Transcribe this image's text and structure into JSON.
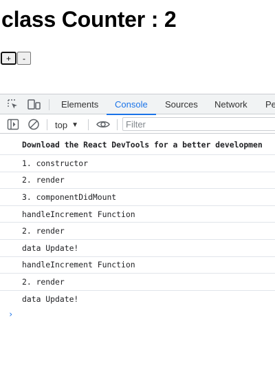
{
  "page": {
    "title": "class Counter : 2",
    "increment_label": "+",
    "decrement_label": "-"
  },
  "devtools": {
    "tabs": [
      "Elements",
      "Console",
      "Sources",
      "Network",
      "Pe"
    ],
    "active_tab": "Console",
    "icons": {
      "inspect": "select-element-icon",
      "device": "device-toolbar-icon",
      "sidebar": "sidebar-toggle-icon",
      "clear": "clear-console-icon",
      "live_expression": "eye-icon"
    },
    "toolbar": {
      "context": "top",
      "filter_placeholder": "Filter"
    },
    "console_messages": [
      "Download the React DevTools for a better developmen",
      "1. constructor",
      "2. render",
      "3. componentDidMount",
      "handleIncrement Function",
      "2. render",
      "data Update!",
      "handleIncrement Function",
      "2. render",
      "data Update!"
    ],
    "prompt_symbol": "›",
    "accent_color": "#1a73e8"
  }
}
